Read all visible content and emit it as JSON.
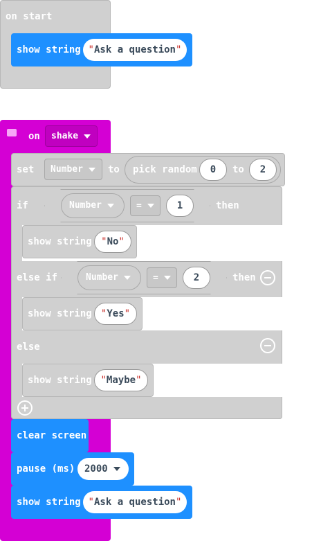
{
  "on_start": {
    "label": "on start",
    "show_string_label": "show string",
    "value": "Ask a question"
  },
  "on_shake": {
    "label": "on",
    "gesture": "shake",
    "set_label": "set",
    "variable": "Number",
    "to_label": "to",
    "pick_random_label": "pick random",
    "random_min": "0",
    "random_to_label": "to",
    "random_max": "2",
    "if_label": "if",
    "then_label": "then",
    "if_var": "Number",
    "if_op": "=",
    "if_value": "1",
    "show_string_label": "show string",
    "if_string": "No",
    "else_if_label": "else if",
    "elseif_var": "Number",
    "elseif_op": "=",
    "elseif_value": "2",
    "elseif_then_label": "then",
    "elseif_string": "Yes",
    "else_label": "else",
    "else_string": "Maybe",
    "clear_screen_label": "clear screen",
    "pause_label": "pause (ms)",
    "pause_value": "2000",
    "final_show_label": "show string",
    "final_string": "Ask a question"
  },
  "colors": {
    "disabled_block": "#d0d0d0",
    "input_block": "#c98fd8",
    "basic_block": "#1e90ff",
    "quote": "#c9302c"
  }
}
